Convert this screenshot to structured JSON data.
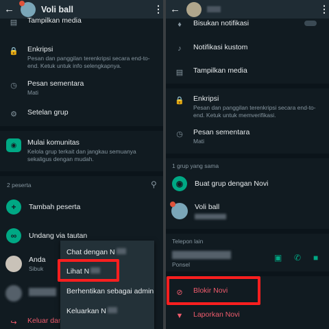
{
  "left": {
    "header": {
      "title": "Voli ball"
    },
    "rows": {
      "media": "Tampilkan media",
      "enkripsi_title": "Enkripsi",
      "enkripsi_sub": "Pesan dan panggilan terenkripsi secara end-to-end. Ketuk untuk info selengkapnya.",
      "pesan_title": "Pesan sementara",
      "pesan_sub": "Mati",
      "setelan": "Setelan grup",
      "komunitas_title": "Mulai komunitas",
      "komunitas_sub": "Kelola grup terkait dan jangkau semuanya sekaligus dengan mudah.",
      "peserta_count": "2 peserta",
      "tambah": "Tambah peserta",
      "undang": "Undang via tautan",
      "anda": "Anda",
      "anda_sub": "Sibuk",
      "keluar": "Keluar dari"
    },
    "menu": {
      "chat": "Chat dengan N",
      "lihat": "Lihat N",
      "berhentikan": "Berhentikan sebagai admin",
      "keluarkan": "Keluarkan N"
    }
  },
  "right": {
    "rows": {
      "bisukan": "Bisukan notifikasi",
      "notif": "Notifikasi kustom",
      "media": "Tampilkan media",
      "enkripsi_title": "Enkripsi",
      "enkripsi_sub": "Pesan dan panggilan terenkripsi secara end-to-end. Ketuk untuk memverifikasi.",
      "pesan_title": "Pesan sementara",
      "pesan_sub": "Mati",
      "grup_sama": "1 grup yang sama",
      "buat_grup": "Buat grup dengan Novi",
      "voli": "Voli ball",
      "telepon": "Telepon lain",
      "ponsel": "Ponsel",
      "blokir": "Blokir Novi",
      "laporkan": "Laporkan Novi"
    }
  },
  "colors": {
    "accent": "#00a884",
    "danger": "#f15c6d",
    "highlight": "#ff1f1f"
  }
}
